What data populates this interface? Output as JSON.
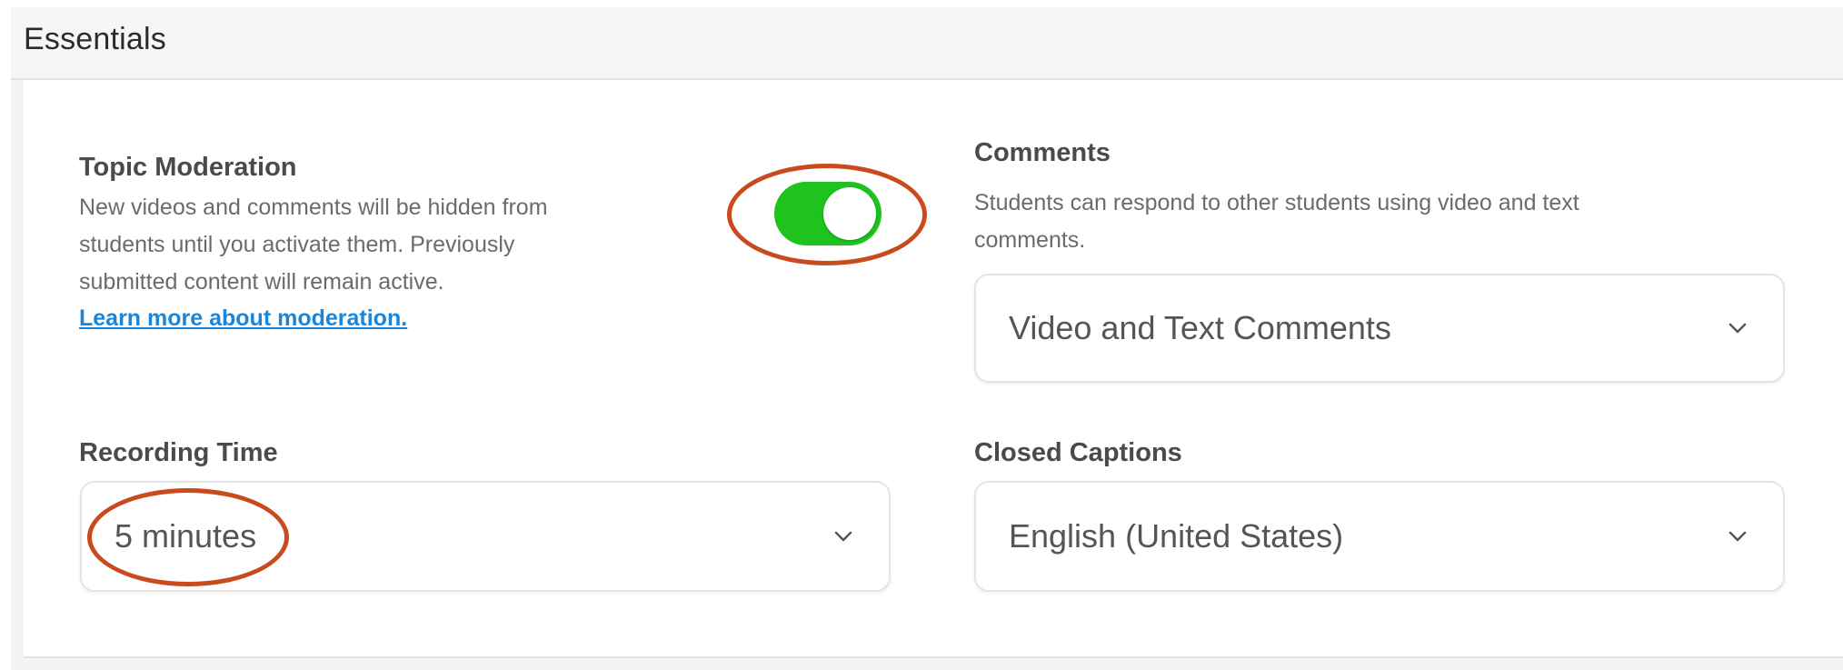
{
  "section": {
    "title": "Essentials"
  },
  "moderation": {
    "label": "Topic Moderation",
    "description_lines": [
      "New videos and comments will be hidden from",
      "students until you activate them. Previously",
      "submitted content will remain active."
    ],
    "link": "Learn more about moderation.",
    "toggle_on": true
  },
  "comments": {
    "label": "Comments",
    "description_lines": [
      "Students can respond to other students using video and text",
      "comments."
    ],
    "selected": "Video and Text Comments"
  },
  "recording_time": {
    "label": "Recording Time",
    "selected": "5 minutes"
  },
  "closed_captions": {
    "label": "Closed Captions",
    "selected": "English (United States)"
  },
  "colors": {
    "toggle_on": "#1ec31e",
    "link": "#1a86d9",
    "annotation": "#c94a1c"
  },
  "icons": {
    "dropdown": "chevron-down-icon"
  }
}
